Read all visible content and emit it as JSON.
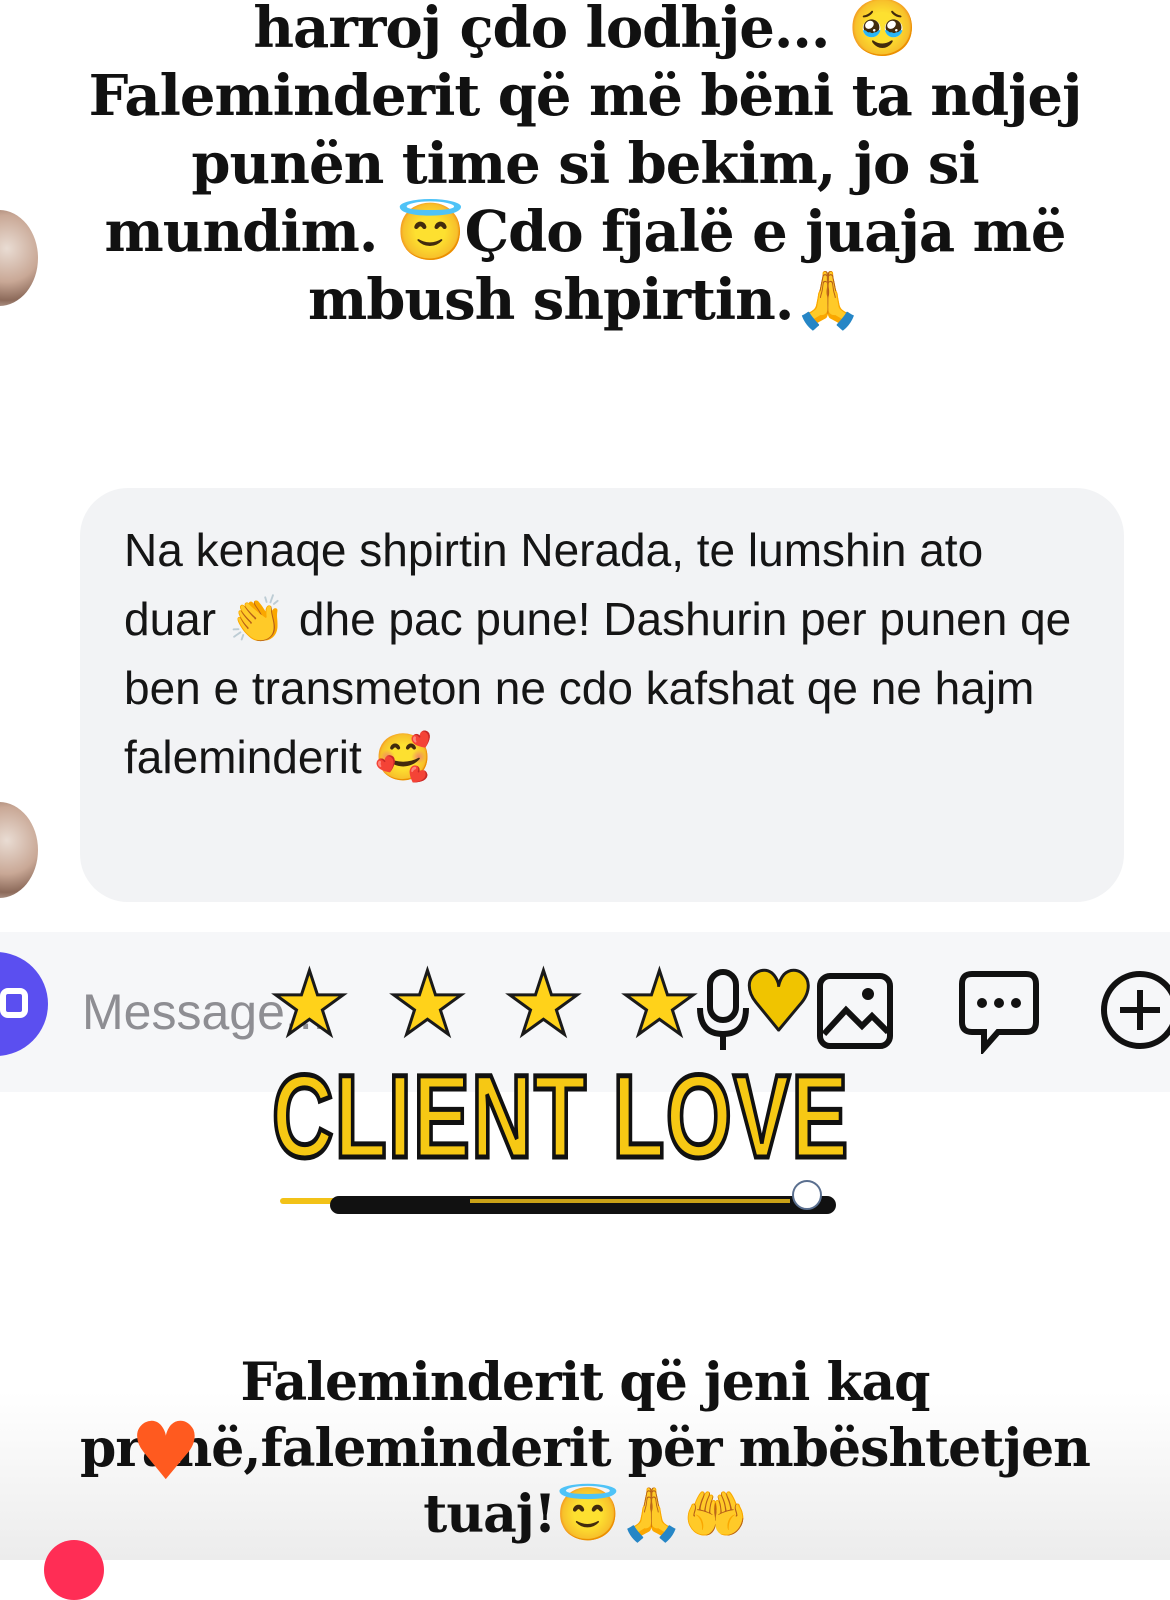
{
  "top_caption": {
    "text": "harroj çdo lodhje... 🥹\nFaleminderit që më bëni ta ndjej punën time si bekim, jo si mundim. 😇Çdo fjalë e juaja më mbush shpirtin.🙏"
  },
  "chat": {
    "message_text": "Na kenaqe shpirtin Nerada, te lumshin ato duar 👏 dhe pac pune! Dashurin per punen qe ben e transmeton ne cdo kafshat qe ne hajm faleminderit 🥰"
  },
  "composer": {
    "placeholder": "Message...",
    "icons": [
      "camera-icon",
      "microphone-icon",
      "gallery-icon",
      "sticker-chat-icon",
      "add-icon"
    ]
  },
  "overlay": {
    "stars": [
      "★",
      "★",
      "★",
      "★"
    ],
    "heart": "♥",
    "headline": "CLIENT LOVE",
    "accent_color": "#f6c814"
  },
  "bottom_caption": {
    "text": "Faleminderit që jeni kaq pranë,faleminderit për mbështetjen tuaj!😇🙏🤲"
  }
}
